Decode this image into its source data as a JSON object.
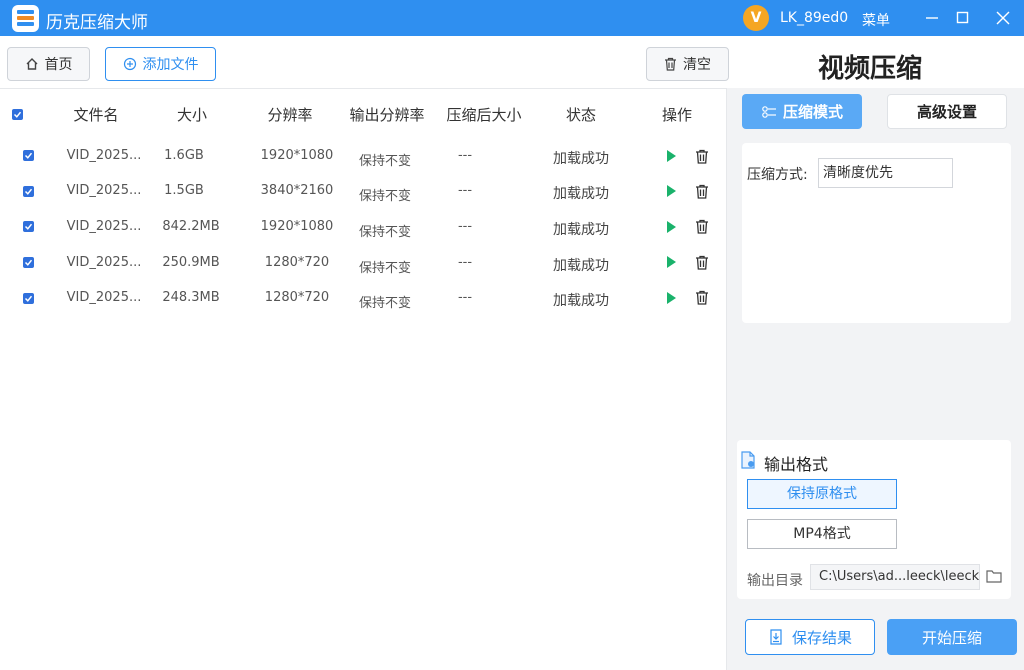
{
  "app": {
    "title": "历克压缩大师",
    "avatar_letter": "V",
    "username": "LK_89ed0",
    "menu_label": "菜单"
  },
  "toolbar": {
    "home_label": "首页",
    "add_label": "添加文件",
    "clear_label": "清空"
  },
  "section_title": "视频压缩",
  "table": {
    "headers": [
      "文件名",
      "大小",
      "分辨率",
      "输出分辨率",
      "压缩后大小",
      "状态",
      "操作"
    ],
    "rows": [
      {
        "name": "VID_2025...",
        "size": "1.6GB",
        "resolution": "1920*1080",
        "output_resolution": "保持不变",
        "compressed_size": "---",
        "status": "加载成功"
      },
      {
        "name": "VID_2025...",
        "size": "1.5GB",
        "resolution": "3840*2160",
        "output_resolution": "保持不变",
        "compressed_size": "---",
        "status": "加载成功"
      },
      {
        "name": "VID_2025...",
        "size": "842.2MB",
        "resolution": "1920*1080",
        "output_resolution": "保持不变",
        "compressed_size": "---",
        "status": "加载成功"
      },
      {
        "name": "VID_2025...",
        "size": "250.9MB",
        "resolution": "1280*720",
        "output_resolution": "保持不变",
        "compressed_size": "---",
        "status": "加载成功"
      },
      {
        "name": "VID_2025...",
        "size": "248.3MB",
        "resolution": "1280*720",
        "output_resolution": "保持不变",
        "compressed_size": "---",
        "status": "加载成功"
      }
    ]
  },
  "right_panel": {
    "tab_mode": "压缩模式",
    "tab_advanced": "高级设置",
    "method_label": "压缩方式:",
    "method_value": "清晰度优先",
    "output_format_title": "输出格式",
    "format_keep": "保持原格式",
    "format_mp4": "MP4格式",
    "output_dir_label": "输出目录",
    "output_dir_value": "C:\\Users\\ad...leeck\\leeck",
    "save_label": "保存结果",
    "start_label": "开始压缩"
  },
  "colors": {
    "accent": "#2f8ff0",
    "play": "#1ab26b",
    "avatar": "#f5a623"
  }
}
